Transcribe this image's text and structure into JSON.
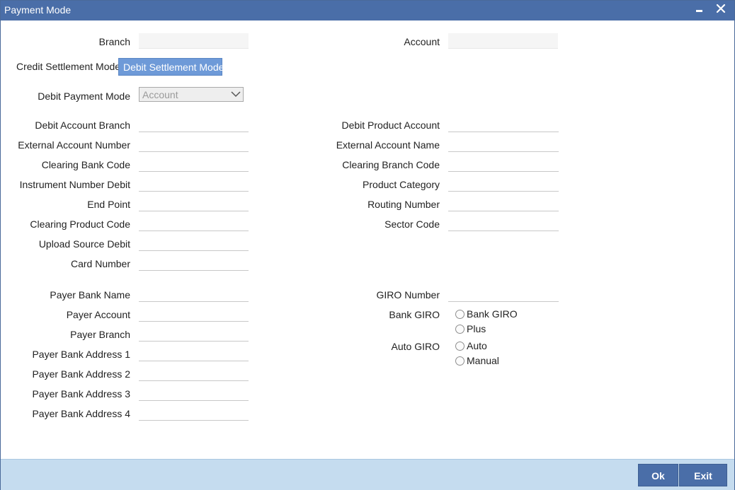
{
  "window": {
    "title": "Payment Mode"
  },
  "header": {
    "branch_label": "Branch",
    "branch_value": "",
    "account_label": "Account",
    "account_value": ""
  },
  "tabs": [
    {
      "label": "Credit Settlement Mode",
      "active": false
    },
    {
      "label": "Debit Settlement Mode",
      "active": true
    }
  ],
  "debit_payment_mode": {
    "label": "Debit Payment Mode",
    "selected": "Account"
  },
  "left_fields": [
    {
      "label": "Debit Account Branch",
      "value": ""
    },
    {
      "label": "External Account Number",
      "value": ""
    },
    {
      "label": "Clearing Bank Code",
      "value": ""
    },
    {
      "label": "Instrument Number Debit",
      "value": ""
    },
    {
      "label": "End Point",
      "value": ""
    },
    {
      "label": "Clearing Product Code",
      "value": ""
    },
    {
      "label": "Upload Source Debit",
      "value": ""
    },
    {
      "label": "Card Number",
      "value": ""
    }
  ],
  "right_fields": [
    {
      "label": "Debit Product Account",
      "value": ""
    },
    {
      "label": "External Account Name",
      "value": ""
    },
    {
      "label": "Clearing Branch Code",
      "value": ""
    },
    {
      "label": "Product Category",
      "value": ""
    },
    {
      "label": "Routing Number",
      "value": ""
    },
    {
      "label": "Sector Code",
      "value": ""
    }
  ],
  "payer_fields": [
    {
      "label": "Payer Bank Name",
      "value": ""
    },
    {
      "label": "Payer Account",
      "value": ""
    },
    {
      "label": "Payer Branch",
      "value": ""
    },
    {
      "label": "Payer Bank Address 1",
      "value": ""
    },
    {
      "label": "Payer Bank Address 2",
      "value": ""
    },
    {
      "label": "Payer Bank Address 3",
      "value": ""
    },
    {
      "label": "Payer Bank Address 4",
      "value": ""
    }
  ],
  "giro": {
    "number_label": "GIRO Number",
    "number_value": "",
    "bank_giro_label": "Bank GIRO",
    "bank_giro_options": [
      "Bank GIRO",
      "Plus"
    ],
    "auto_giro_label": "Auto GIRO",
    "auto_giro_options": [
      "Auto",
      "Manual"
    ]
  },
  "footer": {
    "ok_label": "Ok",
    "exit_label": "Exit"
  },
  "colors": {
    "titlebar": "#4a6ea8",
    "active_tab": "#6e9ad8",
    "footer": "#c5dcef",
    "button": "#4a6ea8"
  }
}
